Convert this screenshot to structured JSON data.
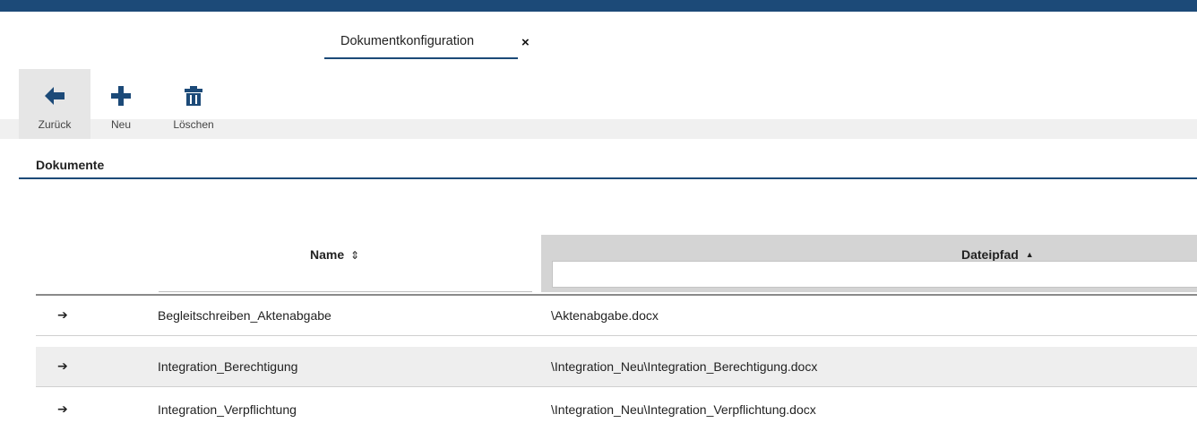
{
  "colors": {
    "accent": "#1c4a78",
    "header_bg": "#d4d4d4",
    "row_alt_bg": "#eeeeee"
  },
  "tab": {
    "label": "Dokumentkonfiguration",
    "close": "×"
  },
  "toolbar": {
    "back_label": "Zurück",
    "new_label": "Neu",
    "delete_label": "Löschen"
  },
  "section": {
    "title": "Dokumente"
  },
  "table": {
    "columns": [
      {
        "label": "Name",
        "sort_indicator": "⇕"
      },
      {
        "label": "Dateipfad",
        "sort_indicator": "▲"
      }
    ],
    "rows": [
      {
        "arrow": "➔",
        "name": "Begleitschreiben_Aktenabgabe",
        "path": "\\Aktenabgabe.docx"
      },
      {
        "arrow": "➔",
        "name": "Integration_Berechtigung",
        "path": "\\Integration_Neu\\Integration_Berechtigung.docx"
      },
      {
        "arrow": "➔",
        "name": "Integration_Verpflichtung",
        "path": "\\Integration_Neu\\Integration_Verpflichtung.docx"
      }
    ]
  }
}
